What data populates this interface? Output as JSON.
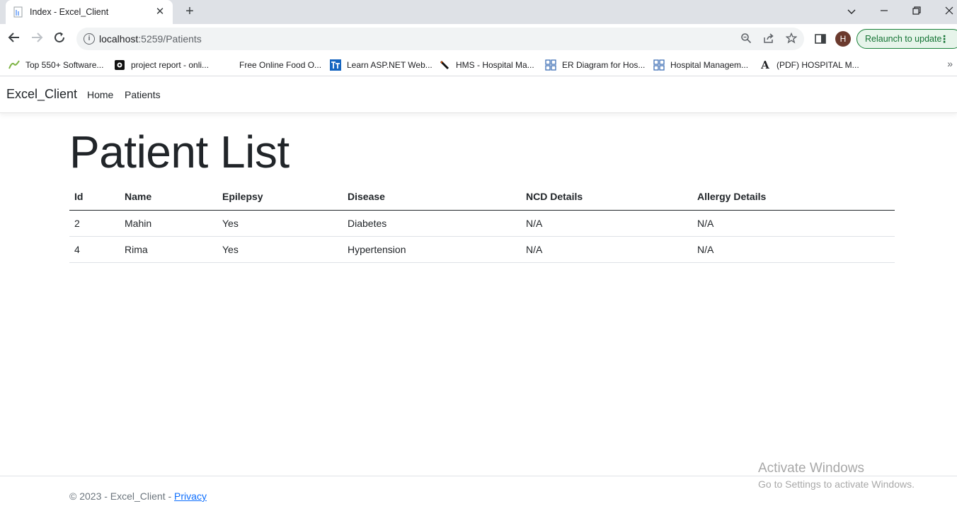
{
  "browser": {
    "tab": {
      "title": "Index - Excel_Client",
      "favicon": "document-icon"
    },
    "address": {
      "host": "localhost",
      "rest": ":5259/Patients"
    },
    "relaunch_label": "Relaunch to update",
    "avatar_initial": "H",
    "bookmarks": [
      {
        "label": "Top 550+ Software...",
        "icon": "leaf-icon"
      },
      {
        "label": "project report - onli...",
        "icon": "square-logo-icon"
      },
      {
        "label": "Free Online Food O...",
        "icon": "blank-icon"
      },
      {
        "label": "Learn ASP.NET Web...",
        "icon": "tt-logo-icon"
      },
      {
        "label": "HMS - Hospital Ma...",
        "icon": "pen-icon"
      },
      {
        "label": "ER Diagram for Hos...",
        "icon": "diagram-icon"
      },
      {
        "label": "Hospital Managem...",
        "icon": "diagram-icon"
      },
      {
        "label": "(PDF) HOSPITAL M...",
        "icon": "letter-a-icon"
      }
    ]
  },
  "site": {
    "brand": "Excel_Client",
    "nav": {
      "home": "Home",
      "patients": "Patients"
    }
  },
  "page": {
    "title": "Patient List",
    "table": {
      "headers": [
        "Id",
        "Name",
        "Epilepsy",
        "Disease",
        "NCD Details",
        "Allergy Details"
      ],
      "rows": [
        [
          "2",
          "Mahin",
          "Yes",
          "Diabetes",
          "N/A",
          "N/A"
        ],
        [
          "4",
          "Rima",
          "Yes",
          "Hypertension",
          "N/A",
          "N/A"
        ]
      ]
    }
  },
  "footer": {
    "copyright": "© 2023 - Excel_Client - ",
    "privacy": "Privacy"
  },
  "watermark": {
    "title": "Activate Windows",
    "subtitle": "Go to Settings to activate Windows."
  },
  "colors": {
    "relaunch_green": "#137333",
    "link_blue": "#0d6efd",
    "avatar_brown": "#6b3a2e"
  }
}
